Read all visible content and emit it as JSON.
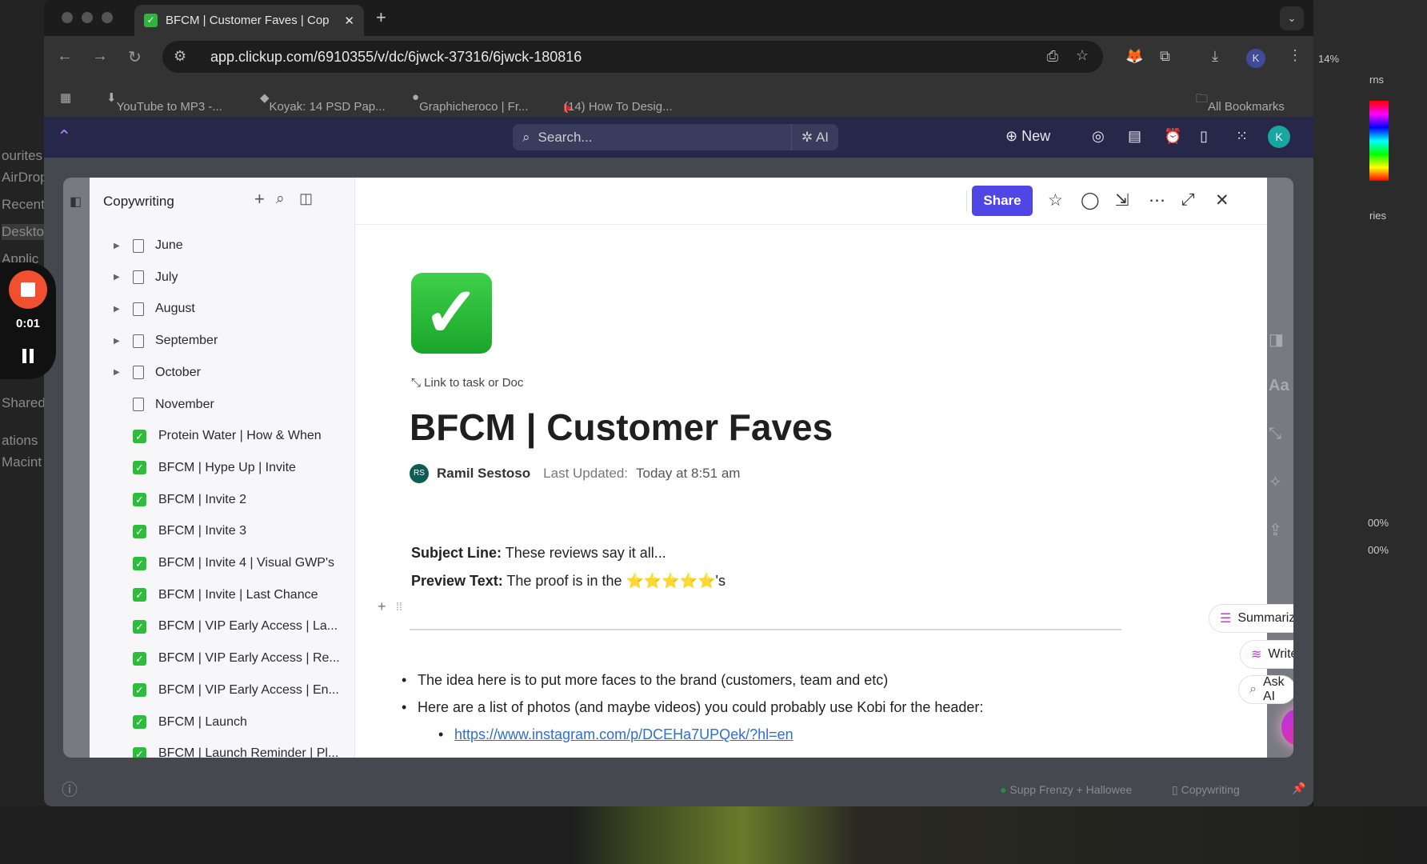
{
  "finder": {
    "items": [
      "ourites",
      "AirDrop",
      "Recents",
      "Desktop",
      "Applic",
      "Shared",
      "ations",
      "Macint"
    ]
  },
  "recorder": {
    "time": "0:01"
  },
  "browser": {
    "tab_title": "BFCM | Customer Faves | Cop",
    "url": "app.clickup.com/6910355/v/dc/6jwck-37316/6jwck-180816",
    "profile_initial": "K",
    "bookmarks": [
      "YouTube to MP3 -...",
      "Koyak: 14 PSD Pap...",
      "Graphicheroco | Fr...",
      "(14) How To Desig..."
    ],
    "all_bookmarks": "All Bookmarks"
  },
  "clickup": {
    "search_placeholder": "Search...",
    "ai_label": "AI",
    "new_label": "New",
    "avatar_initial": "K",
    "brand_color": "#7b68ee"
  },
  "sidebar": {
    "title": "Copywriting",
    "items": [
      {
        "label": "June",
        "type": "doc",
        "expandable": true
      },
      {
        "label": "July",
        "type": "doc",
        "expandable": true
      },
      {
        "label": "August",
        "type": "doc",
        "expandable": true
      },
      {
        "label": "September",
        "type": "doc",
        "expandable": true
      },
      {
        "label": "October",
        "type": "doc",
        "expandable": true
      },
      {
        "label": "November",
        "type": "doc",
        "expandable": false
      },
      {
        "label": "Protein Water | How & When",
        "type": "check"
      },
      {
        "label": "BFCM | Hype Up | Invite",
        "type": "check"
      },
      {
        "label": "BFCM | Invite 2",
        "type": "check"
      },
      {
        "label": "BFCM | Invite 3",
        "type": "check"
      },
      {
        "label": "BFCM | Invite 4 | Visual GWP's",
        "type": "check"
      },
      {
        "label": "BFCM | Invite | Last Chance",
        "type": "check"
      },
      {
        "label": "BFCM | VIP Early Access | La...",
        "type": "check"
      },
      {
        "label": "BFCM | VIP Early Access | Re...",
        "type": "check"
      },
      {
        "label": "BFCM | VIP Early Access | En...",
        "type": "check"
      },
      {
        "label": "BFCM | Launch",
        "type": "check"
      },
      {
        "label": "BFCM | Launch Reminder | Pl...",
        "type": "check"
      }
    ]
  },
  "doc": {
    "share_label": "Share",
    "share_color": "#4f46e5",
    "link_label": "Link to task or Doc",
    "title": "BFCM | Customer Faves",
    "author_initials": "RS",
    "author": "Ramil Sestoso",
    "last_updated_label": "Last Updated:",
    "last_updated": "Today at 8:51 am",
    "subject_label": "Subject Line:",
    "subject": "These reviews say it all...",
    "preview_label": "Preview Text:",
    "preview": "The proof is in the ⭐⭐⭐⭐⭐'s",
    "bullets": [
      "The idea here is to put more faces to the brand (customers, team and etc)",
      "Here are a list of photos (and maybe videos) you could probably use Kobi for the header:"
    ],
    "links": [
      "https://www.instagram.com/p/DCEHa7UPQek/?hl=en"
    ],
    "format_icon_label": "Aa"
  },
  "ai": {
    "summarize": "Summarize",
    "writer": "Writer",
    "ask": "Ask AI"
  },
  "bottom": {
    "breadcrumb1": "Supp Frenzy + Hallowee",
    "breadcrumb2": "Copywriting"
  },
  "photoshop": {
    "zoom": "14%",
    "labels": [
      "rns",
      "ries"
    ],
    "opacity1": "00%",
    "opacity2": "00%"
  }
}
